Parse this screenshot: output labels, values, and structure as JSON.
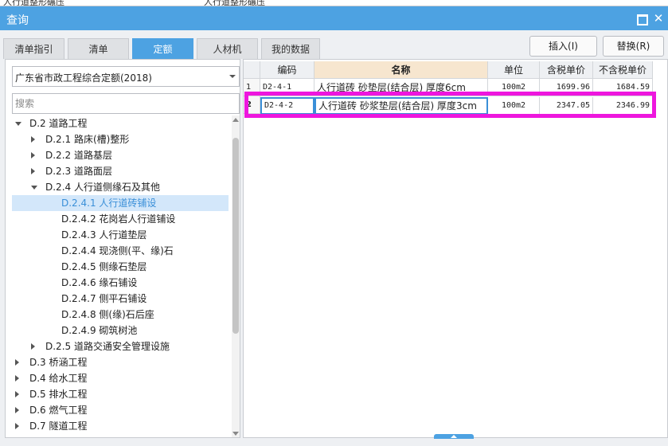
{
  "title_strip": {
    "left": "人行道整形碾压",
    "mid": "人行道整形碾压"
  },
  "window": {
    "title": "查询"
  },
  "tabs": [
    "清单指引",
    "清单",
    "定额",
    "人材机",
    "我的数据"
  ],
  "active_tab": "定额",
  "buttons": {
    "insert": "插入(I)",
    "replace": "替换(R)"
  },
  "library": {
    "selected": "广东省市政工程综合定额(2018)"
  },
  "search": {
    "placeholder": "搜索"
  },
  "tree": [
    {
      "label": "D.2 道路工程",
      "level": 0,
      "state": "open"
    },
    {
      "label": "D.2.1 路床(槽)整形",
      "level": 1,
      "state": "closed"
    },
    {
      "label": "D.2.2 道路基层",
      "level": 1,
      "state": "closed"
    },
    {
      "label": "D.2.3 道路面层",
      "level": 1,
      "state": "closed"
    },
    {
      "label": "D.2.4 人行道侧缘石及其他",
      "level": 1,
      "state": "open"
    },
    {
      "label": "D.2.4.1 人行道砖铺设",
      "level": 2,
      "state": "leaf",
      "selected": true
    },
    {
      "label": "D.2.4.2 花岗岩人行道铺设",
      "level": 2,
      "state": "leaf"
    },
    {
      "label": "D.2.4.3 人行道垫层",
      "level": 2,
      "state": "leaf"
    },
    {
      "label": "D.2.4.4 现浇侧(平、缘)石",
      "level": 2,
      "state": "leaf"
    },
    {
      "label": "D.2.4.5 侧缘石垫层",
      "level": 2,
      "state": "leaf"
    },
    {
      "label": "D.2.4.6 缘石铺设",
      "level": 2,
      "state": "leaf"
    },
    {
      "label": "D.2.4.7 侧平石铺设",
      "level": 2,
      "state": "leaf"
    },
    {
      "label": "D.2.4.8 侧(缘)石后座",
      "level": 2,
      "state": "leaf"
    },
    {
      "label": "D.2.4.9 砌筑树池",
      "level": 2,
      "state": "leaf"
    },
    {
      "label": "D.2.5 道路交通安全管理设施",
      "level": 1,
      "state": "closed"
    },
    {
      "label": "D.3 桥涵工程",
      "level": 0,
      "state": "closed"
    },
    {
      "label": "D.4 给水工程",
      "level": 0,
      "state": "closed"
    },
    {
      "label": "D.5 排水工程",
      "level": 0,
      "state": "closed"
    },
    {
      "label": "D.6 燃气工程",
      "level": 0,
      "state": "closed"
    },
    {
      "label": "D.7 隧道工程",
      "level": 0,
      "state": "closed"
    }
  ],
  "table": {
    "headers": [
      "",
      "编码",
      "名称",
      "单位",
      "含税单价",
      "不含税单价"
    ],
    "rows": [
      {
        "no": "1",
        "code": "D2-4-1",
        "name": "人行道砖 砂垫层(结合层) 厚度6cm",
        "unit": "100m2",
        "price_tax": "1699.96",
        "price_notax": "1684.59"
      },
      {
        "no": "2",
        "code": "D2-4-2",
        "name": "人行道砖 砂浆垫层(结合层) 厚度3cm",
        "unit": "100m2",
        "price_tax": "2347.05",
        "price_notax": "2346.99"
      }
    ]
  },
  "colors": {
    "accent": "#4da2e2",
    "highlight_box": "#ee16de",
    "header_name_bg": "#f7e6cf"
  }
}
